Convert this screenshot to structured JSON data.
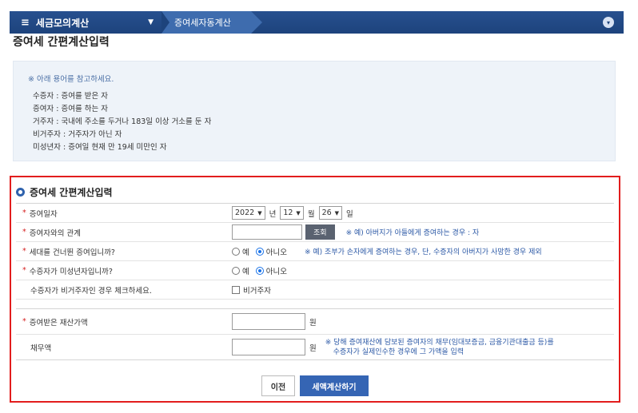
{
  "topbar": {
    "menu_label": "세금모의계산",
    "breadcrumb": "증여세자동계산"
  },
  "page_title": "증여세 간편계산입력",
  "info": {
    "note": "※ 아래 용어를 참고하세요.",
    "lines": [
      "수증자 : 증여를 받은 자",
      "증여자 : 증여를 하는 자",
      "거주자 : 국내에 주소를 두거나 183일 이상 거소를 둔 자",
      "비거주자 : 거주자가 아닌 자",
      "미성년자 : 증여일 현재 만 19세 미만인 자"
    ]
  },
  "form": {
    "section_title": "증여세 간편계산입력",
    "gift_date": {
      "label": "증여일자",
      "year": "2022",
      "year_unit": "년",
      "month": "12",
      "month_unit": "월",
      "day": "26",
      "day_unit": "일"
    },
    "relation": {
      "label": "증여자와의 관계",
      "value": "",
      "lookup_button": "조회",
      "hint": "※ 예) 아버지가 아들에게 증여하는 경우 : 자"
    },
    "skip_generation": {
      "label": "세대를 건너뛴 증여입니까?",
      "opt_yes": "예",
      "opt_no": "아니오",
      "selected": "아니오",
      "hint": "※ 예) 조부가 손자에게 증여하는 경우, 단, 수증자의 아버지가 사망한 경우 제외"
    },
    "minor": {
      "label": "수증자가 미성년자입니까?",
      "opt_yes": "예",
      "opt_no": "아니오",
      "selected": "아니오"
    },
    "nonresident": {
      "label": "수증자가 비거주자인 경우 체크하세요.",
      "checkbox_label": "비거주자",
      "checked": false
    },
    "property_value": {
      "label": "증여받은 재산가액",
      "value": "",
      "unit": "원"
    },
    "debt": {
      "label": "채무액",
      "value": "",
      "unit": "원",
      "hint_line1": "※ 당해 증여재산에 담보된 증여자의 채무(임대보증금, 금융기관대출금 등)를",
      "hint_line2": "수증자가 실제인수한 경우에 그 가액을 입력"
    },
    "required_mark": "*"
  },
  "buttons": {
    "prev": "이전",
    "calculate": "세액계산하기"
  }
}
